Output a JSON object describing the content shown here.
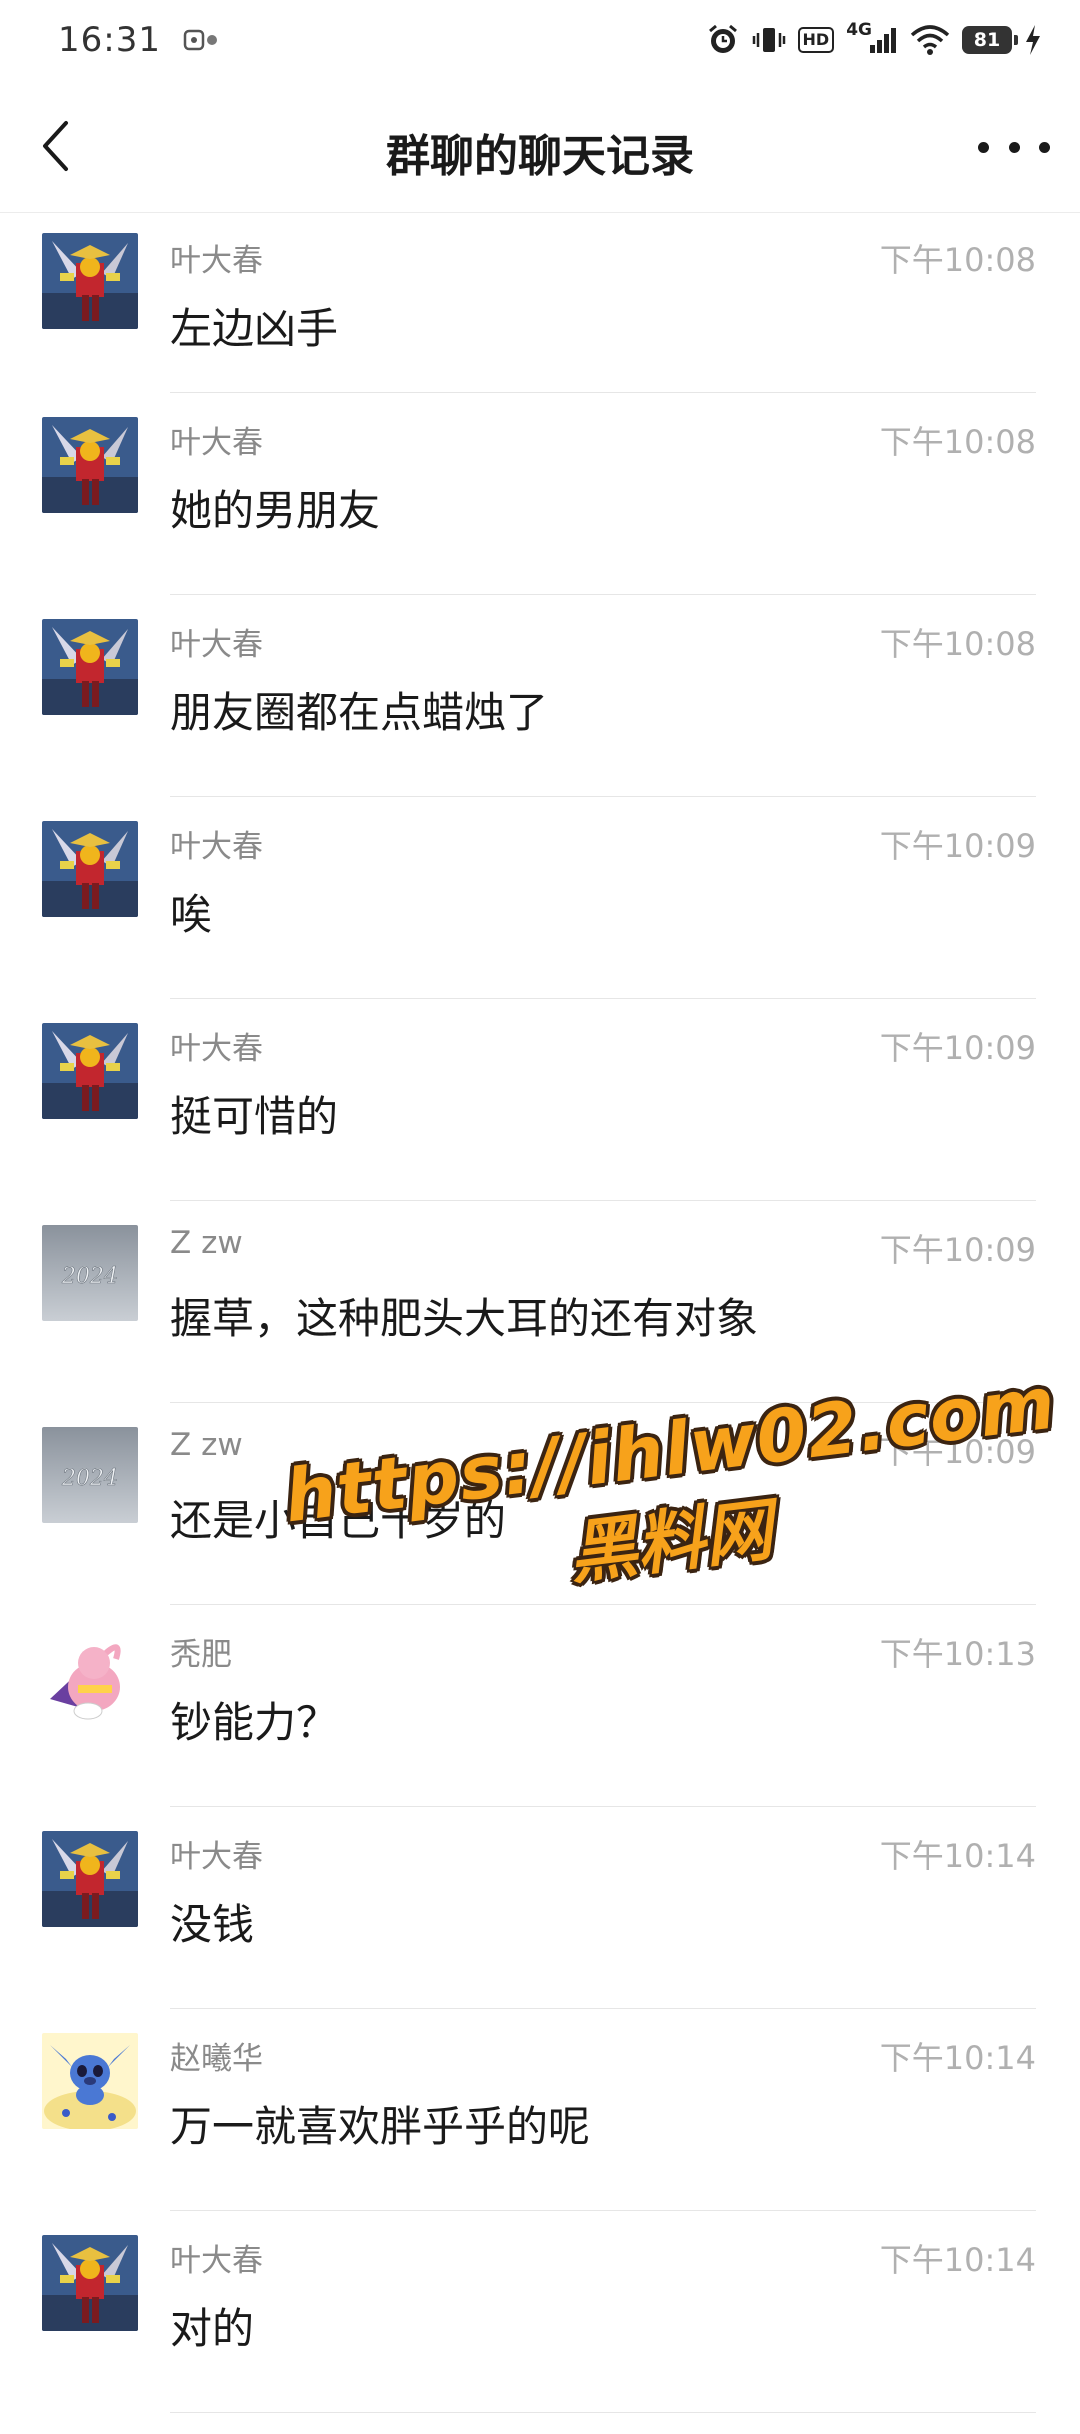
{
  "status_bar": {
    "time": "16:31",
    "network": "4G",
    "hd": "HD",
    "battery": "81"
  },
  "nav": {
    "title": "群聊的聊天记录"
  },
  "messages": [
    {
      "sender": "叶大春",
      "time": "下午10:08",
      "text": "左边凶手",
      "avatar": "robot"
    },
    {
      "sender": "叶大春",
      "time": "下午10:08",
      "text": "她的男朋友",
      "avatar": "robot"
    },
    {
      "sender": "叶大春",
      "time": "下午10:08",
      "text": "朋友圈都在点蜡烛了",
      "avatar": "robot"
    },
    {
      "sender": "叶大春",
      "time": "下午10:09",
      "text": "唉",
      "avatar": "robot"
    },
    {
      "sender": "叶大春",
      "time": "下午10:09",
      "text": "挺可惜的",
      "avatar": "robot"
    },
    {
      "sender": "Z zw",
      "time": "下午10:09",
      "text": "握草，这种肥头大耳的还有对象",
      "avatar": "snow-2024"
    },
    {
      "sender": "Z zw",
      "time": "下午10:09",
      "text": "还是小自己十岁的",
      "avatar": "snow-2024"
    },
    {
      "sender": "秃肥",
      "time": "下午10:13",
      "text": "钞能力？",
      "avatar": "majin-buu"
    },
    {
      "sender": "叶大春",
      "time": "下午10:14",
      "text": "没钱",
      "avatar": "robot"
    },
    {
      "sender": "赵曦华",
      "time": "下午10:14",
      "text": "万一就喜欢胖乎乎的呢",
      "avatar": "stitch"
    },
    {
      "sender": "叶大春",
      "time": "下午10:14",
      "text": "对的",
      "avatar": "robot"
    }
  ],
  "watermark": {
    "url": "https://ihlw02.com",
    "label": "黑料网",
    "color": "#f7a21b"
  }
}
